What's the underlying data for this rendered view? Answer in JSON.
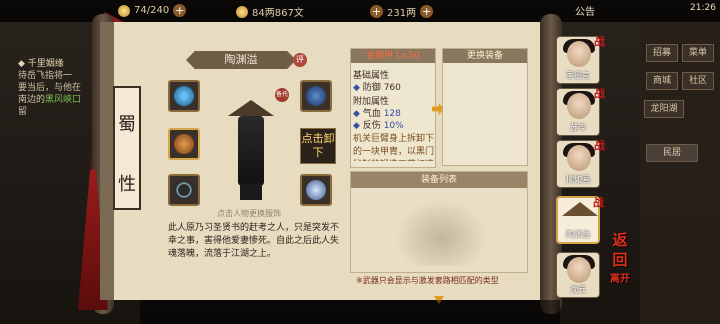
{
  "topbar": {
    "res1": "74/240",
    "res2": "84两867文",
    "res3": "231两",
    "notice": "公告",
    "clock": "21:26"
  },
  "quest": {
    "title": "千里姻缘",
    "line1": "待岳飞指将一",
    "line2": "要当后，与他在",
    "line3_prefix": "南边的",
    "line3_hl": "黑风峡口",
    "line4": "留"
  },
  "sect": {
    "c1": "蜀",
    "c2": "性"
  },
  "character": {
    "name": "陶渊溢",
    "ping": "评",
    "tip": "点击人物更换服饰",
    "equip_flag": "备托",
    "unequip": "点击卸下",
    "bio": "此人原乃习圣贤书的赶考之人，只是突发不幸之事，害得他爱妻惨死。自此之后此人失魂落魄，流落于江湖之上。"
  },
  "equip": {
    "name": "金刚甲 Lv.50",
    "base_title": "基础属性",
    "base_label": "防御",
    "base_val": "760",
    "extra_title": "附加属性",
    "extra1_label": "气血",
    "extra1_val": "128",
    "extra2_label": "反伤",
    "extra2_val": "10%",
    "desc": "机关巨臂身上拆卸下的一块甲胄，以黑门秘制的锻造工艺打造而成。"
  },
  "replace": {
    "title": "更换装备"
  },
  "list": {
    "title": "装备列表",
    "note": "※武器只会显示与激发套路相匹配的类型"
  },
  "characters": [
    {
      "name": "季墨言"
    },
    {
      "name": "苏岑"
    },
    {
      "name": "柳如画"
    },
    {
      "name": "陶渊溢"
    },
    {
      "name": "沈云"
    }
  ],
  "battle_mark": "战",
  "menu": {
    "b1": "招募",
    "b2": "菜单",
    "b3": "商城",
    "b4": "社区",
    "b5": "龙阳湖",
    "b6": "民居"
  },
  "back": {
    "c1": "返",
    "c2": "回",
    "c3": "离开"
  }
}
